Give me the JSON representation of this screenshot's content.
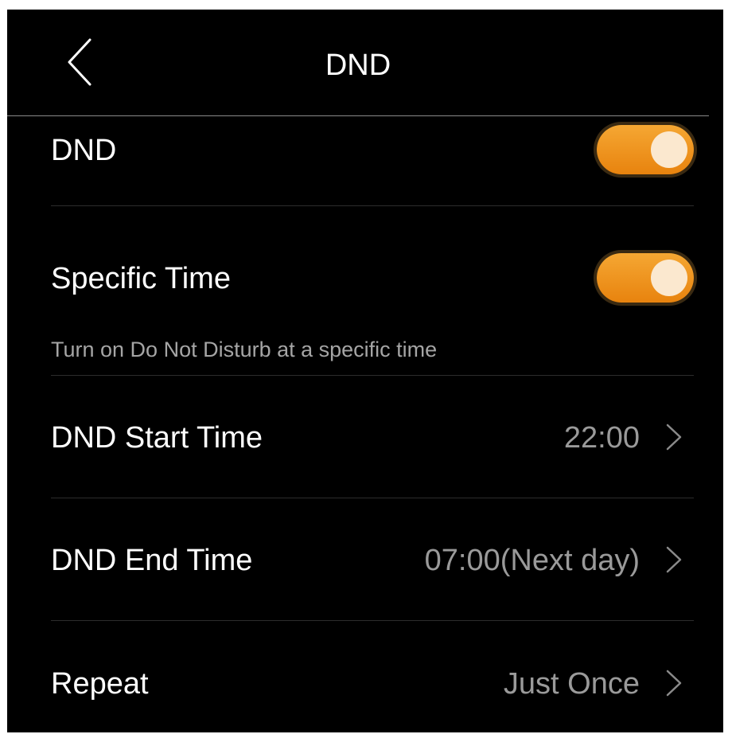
{
  "header": {
    "title": "DND",
    "back_icon": "chevron-left-icon"
  },
  "settings": {
    "dnd": {
      "label": "DND",
      "enabled": true
    },
    "specific_time": {
      "label": "Specific Time",
      "enabled": true,
      "hint": "Turn on Do Not Disturb at a specific time"
    },
    "start_time": {
      "label": "DND Start Time",
      "value": "22:00"
    },
    "end_time": {
      "label": "DND End Time",
      "value": "07:00(Next day)"
    },
    "repeat": {
      "label": "Repeat",
      "value": "Just Once"
    }
  },
  "colors": {
    "background": "#000000",
    "toggle_on": "#f0961f",
    "value_text": "#9a9a9a",
    "hint_text": "#a5a5a5"
  }
}
